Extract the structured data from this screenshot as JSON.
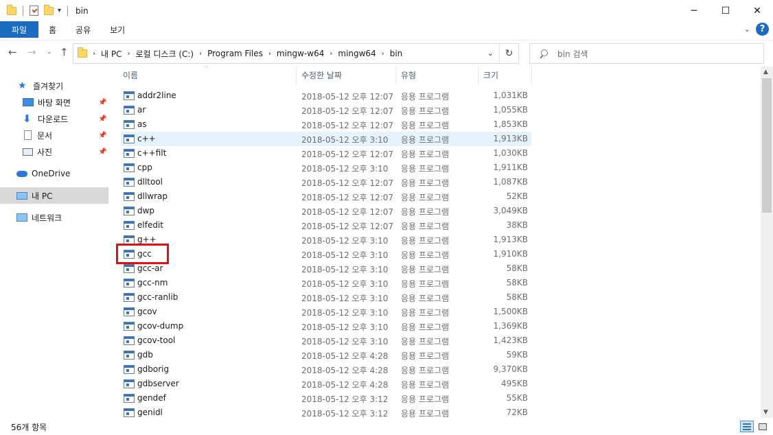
{
  "window": {
    "title": "bin"
  },
  "ribbon": {
    "tabs": [
      "파일",
      "홈",
      "공유",
      "보기"
    ]
  },
  "address": {
    "crumbs": [
      "내 PC",
      "로컬 디스크 (C:)",
      "Program Files",
      "mingw-w64",
      "mingw64",
      "bin"
    ]
  },
  "search": {
    "placeholder": "bin 검색"
  },
  "nav": {
    "quick_access": "즐겨찾기",
    "items": [
      "바탕 화면",
      "다운로드",
      "문서",
      "사진"
    ],
    "onedrive": "OneDrive",
    "this_pc": "내 PC",
    "network": "네트워크"
  },
  "columns": {
    "name": "이름",
    "date": "수정한 날짜",
    "type": "유형",
    "size": "크기"
  },
  "files": [
    {
      "name": "addr2line",
      "date": "2018-05-12 오후 12:07",
      "type": "응용 프로그램",
      "size": "1,031KB"
    },
    {
      "name": "ar",
      "date": "2018-05-12 오후 12:07",
      "type": "응용 프로그램",
      "size": "1,055KB"
    },
    {
      "name": "as",
      "date": "2018-05-12 오후 12:07",
      "type": "응용 프로그램",
      "size": "1,853KB"
    },
    {
      "name": "c++",
      "date": "2018-05-12 오후 3:10",
      "type": "응용 프로그램",
      "size": "1,913KB"
    },
    {
      "name": "c++filt",
      "date": "2018-05-12 오후 12:07",
      "type": "응용 프로그램",
      "size": "1,030KB"
    },
    {
      "name": "cpp",
      "date": "2018-05-12 오후 3:10",
      "type": "응용 프로그램",
      "size": "1,911KB"
    },
    {
      "name": "dlltool",
      "date": "2018-05-12 오후 12:07",
      "type": "응용 프로그램",
      "size": "1,087KB"
    },
    {
      "name": "dllwrap",
      "date": "2018-05-12 오후 12:07",
      "type": "응용 프로그램",
      "size": "52KB"
    },
    {
      "name": "dwp",
      "date": "2018-05-12 오후 12:07",
      "type": "응용 프로그램",
      "size": "3,049KB"
    },
    {
      "name": "elfedit",
      "date": "2018-05-12 오후 12:07",
      "type": "응용 프로그램",
      "size": "38KB"
    },
    {
      "name": "g++",
      "date": "2018-05-12 오후 3:10",
      "type": "응용 프로그램",
      "size": "1,913KB"
    },
    {
      "name": "gcc",
      "date": "2018-05-12 오후 3:10",
      "type": "응용 프로그램",
      "size": "1,910KB"
    },
    {
      "name": "gcc-ar",
      "date": "2018-05-12 오후 3:10",
      "type": "응용 프로그램",
      "size": "58KB"
    },
    {
      "name": "gcc-nm",
      "date": "2018-05-12 오후 3:10",
      "type": "응용 프로그램",
      "size": "58KB"
    },
    {
      "name": "gcc-ranlib",
      "date": "2018-05-12 오후 3:10",
      "type": "응용 프로그램",
      "size": "58KB"
    },
    {
      "name": "gcov",
      "date": "2018-05-12 오후 3:10",
      "type": "응용 프로그램",
      "size": "1,500KB"
    },
    {
      "name": "gcov-dump",
      "date": "2018-05-12 오후 3:10",
      "type": "응용 프로그램",
      "size": "1,369KB"
    },
    {
      "name": "gcov-tool",
      "date": "2018-05-12 오후 3:10",
      "type": "응용 프로그램",
      "size": "1,423KB"
    },
    {
      "name": "gdb",
      "date": "2018-05-12 오후 4:28",
      "type": "응용 프로그램",
      "size": "59KB"
    },
    {
      "name": "gdborig",
      "date": "2018-05-12 오후 4:28",
      "type": "응용 프로그램",
      "size": "9,370KB"
    },
    {
      "name": "gdbserver",
      "date": "2018-05-12 오후 4:28",
      "type": "응용 프로그램",
      "size": "495KB"
    },
    {
      "name": "gendef",
      "date": "2018-05-12 오후 3:12",
      "type": "응용 프로그램",
      "size": "55KB"
    },
    {
      "name": "genidl",
      "date": "2018-05-12 오후 3:12",
      "type": "응용 프로그램",
      "size": "72KB"
    }
  ],
  "status": {
    "count": "56개 항목"
  }
}
